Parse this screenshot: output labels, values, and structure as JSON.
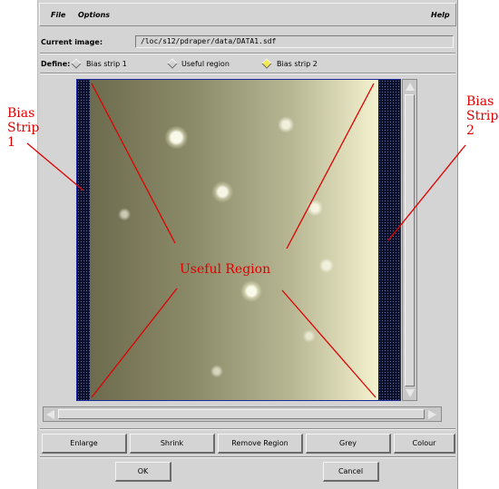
{
  "menubar": {
    "file_label": "File",
    "options_label": "Options",
    "help_label": "Help"
  },
  "current_image": {
    "label": "Current image:",
    "value": "/loc/s12/pdraper/data/DATA1.sdf"
  },
  "define": {
    "label": "Define:",
    "options": [
      {
        "label": "Bias strip 1",
        "selected": false
      },
      {
        "label": "Useful region",
        "selected": false
      },
      {
        "label": "Bias strip 2",
        "selected": true
      }
    ]
  },
  "annotations": {
    "bias_strip_1": [
      "Bias",
      "Strip",
      "1"
    ],
    "bias_strip_2": [
      "Bias",
      "Strip",
      "2"
    ],
    "useful_region": "Useful Region"
  },
  "buttons": {
    "enlarge": "Enlarge",
    "shrink": "Shrink",
    "remove_region": "Remove Region",
    "grey": "Grey",
    "colour": "Colour",
    "ok": "OK",
    "cancel": "Cancel"
  },
  "colors": {
    "annotation": "#e00000",
    "selected_radio": "#f1e94f",
    "region_outline": "#1e2aa0"
  },
  "icons": {
    "scroll_up": "triangle-up-icon",
    "scroll_down": "triangle-down-icon",
    "scroll_left": "triangle-left-icon",
    "scroll_right": "triangle-right-icon"
  }
}
